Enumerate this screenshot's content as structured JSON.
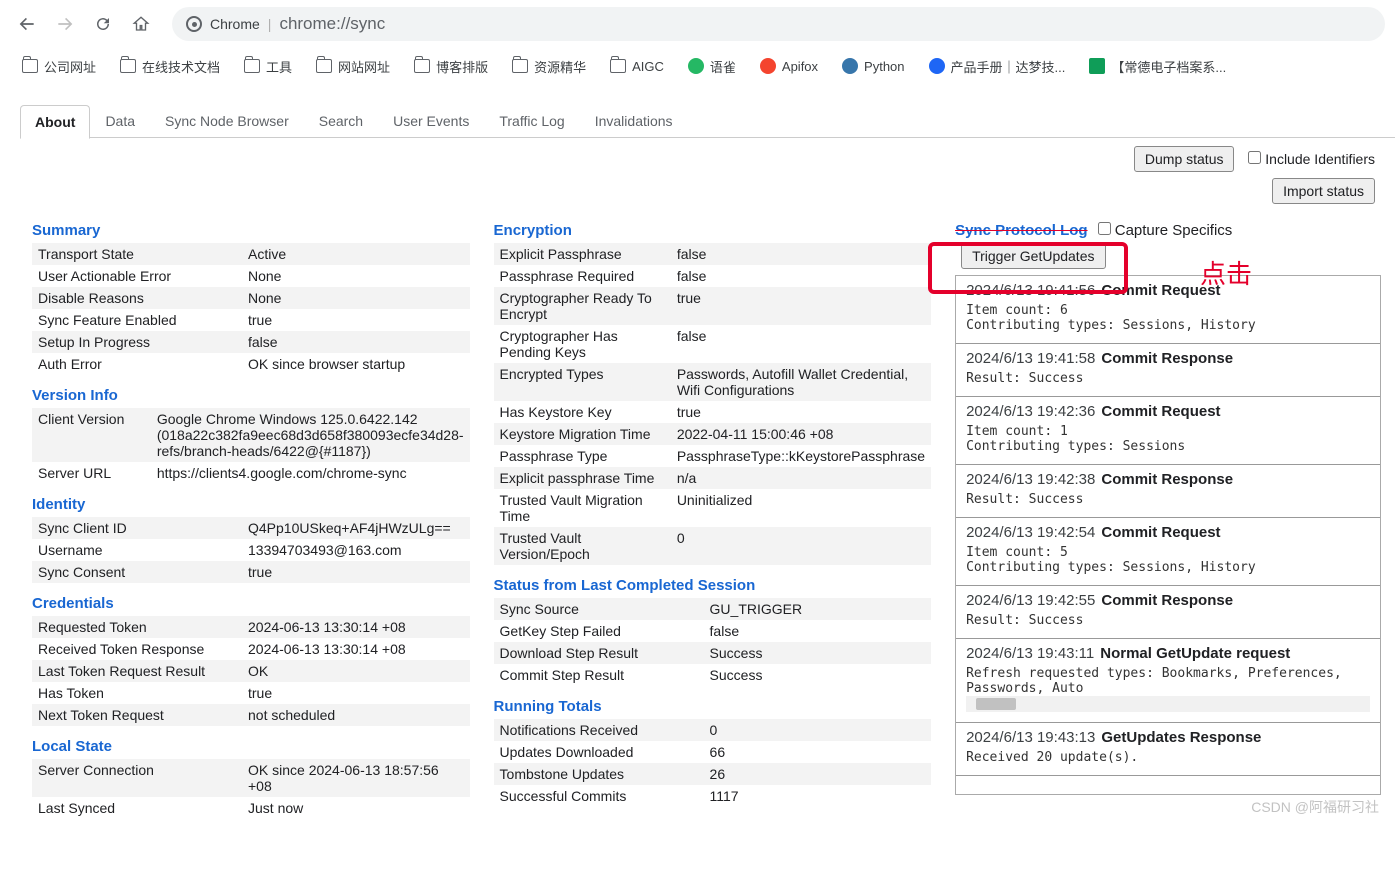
{
  "browser": {
    "address_chip": "Chrome",
    "address_url": "chrome://sync"
  },
  "bookmarks": [
    {
      "label": "公司网址",
      "icon": "folder"
    },
    {
      "label": "在线技术文档",
      "icon": "folder"
    },
    {
      "label": "工具",
      "icon": "folder"
    },
    {
      "label": "网站网址",
      "icon": "folder"
    },
    {
      "label": "博客排版",
      "icon": "folder"
    },
    {
      "label": "资源精华",
      "icon": "folder"
    },
    {
      "label": "AIGC",
      "icon": "folder"
    },
    {
      "label": "语雀",
      "icon": "yuque",
      "color": "#25b864"
    },
    {
      "label": "Apifox",
      "icon": "apifox",
      "color": "#f4442e"
    },
    {
      "label": "Python",
      "icon": "python",
      "color": "#3776ab"
    },
    {
      "label": "产品手册｜达梦技...",
      "icon": "dm",
      "color": "#1e66f5"
    },
    {
      "label": "【常德电子档案系...",
      "icon": "sheets"
    }
  ],
  "tabs": [
    "About",
    "Data",
    "Sync Node Browser",
    "Search",
    "User Events",
    "Traffic Log",
    "Invalidations"
  ],
  "active_tab": "About",
  "controls": {
    "dump": "Dump status",
    "include_identifiers": "Include Identifiers",
    "import": "Import status"
  },
  "col1": {
    "summary": {
      "title": "Summary",
      "rows": [
        [
          "Transport State",
          "Active"
        ],
        [
          "User Actionable Error",
          "None"
        ],
        [
          "Disable Reasons",
          "None"
        ],
        [
          "Sync Feature Enabled",
          "true"
        ],
        [
          "Setup In Progress",
          "false"
        ],
        [
          "Auth Error",
          "OK since browser startup"
        ]
      ]
    },
    "version": {
      "title": "Version Info",
      "rows": [
        [
          "Client Version",
          "Google Chrome Windows 125.0.6422.142 (018a22c382fa9eec68d3d658f380093ecfe34d28-refs/branch-heads/6422@{#1187})"
        ],
        [
          "Server URL",
          "https://clients4.google.com/chrome-sync"
        ]
      ]
    },
    "identity": {
      "title": "Identity",
      "rows": [
        [
          "Sync Client ID",
          "Q4Pp10USkeq+AF4jHWzULg=="
        ],
        [
          "Username",
          "13394703493@163.com"
        ],
        [
          "Sync Consent",
          "true"
        ]
      ]
    },
    "credentials": {
      "title": "Credentials",
      "rows": [
        [
          "Requested Token",
          "2024-06-13 13:30:14 +08"
        ],
        [
          "Received Token Response",
          "2024-06-13 13:30:14 +08"
        ],
        [
          "Last Token Request Result",
          "OK"
        ],
        [
          "Has Token",
          "true"
        ],
        [
          "Next Token Request",
          "not scheduled"
        ]
      ]
    },
    "local_state": {
      "title": "Local State",
      "rows": [
        [
          "Server Connection",
          "OK since 2024-06-13 18:57:56 +08"
        ],
        [
          "Last Synced",
          "Just now"
        ]
      ]
    }
  },
  "col2": {
    "encryption": {
      "title": "Encryption",
      "rows": [
        [
          "Explicit Passphrase",
          "false"
        ],
        [
          "Passphrase Required",
          "false"
        ],
        [
          "Cryptographer Ready To Encrypt",
          "true"
        ],
        [
          "Cryptographer Has Pending Keys",
          "false"
        ],
        [
          "Encrypted Types",
          "Passwords, Autofill Wallet Credential, Wifi Configurations"
        ],
        [
          "Has Keystore Key",
          "true"
        ],
        [
          "Keystore Migration Time",
          "2022-04-11 15:00:46 +08"
        ],
        [
          "Passphrase Type",
          "PassphraseType::kKeystorePassphrase"
        ],
        [
          "Explicit passphrase Time",
          "n/a"
        ],
        [
          "Trusted Vault Migration Time",
          "Uninitialized"
        ],
        [
          "Trusted Vault Version/Epoch",
          "0"
        ]
      ]
    },
    "status": {
      "title": "Status from Last Completed Session",
      "rows": [
        [
          "Sync Source",
          "GU_TRIGGER"
        ],
        [
          "GetKey Step Failed",
          "false"
        ],
        [
          "Download Step Result",
          "Success"
        ],
        [
          "Commit Step Result",
          "Success"
        ]
      ]
    },
    "running": {
      "title": "Running Totals",
      "rows": [
        [
          "Notifications Received",
          "0"
        ],
        [
          "Updates Downloaded",
          "66"
        ],
        [
          "Tombstone Updates",
          "26"
        ],
        [
          "Successful Commits",
          "1117"
        ]
      ]
    }
  },
  "protocol_log": {
    "title": "Sync Protocol Log",
    "capture_label": "Capture Specifics",
    "trigger_btn": "Trigger GetUpdates",
    "entries": [
      {
        "ts": "2024/6/13 19:41:56",
        "name": "Commit Request",
        "body": "Item count: 6\nContributing types: Sessions, History"
      },
      {
        "ts": "2024/6/13 19:41:58",
        "name": "Commit Response",
        "body": "Result: Success"
      },
      {
        "ts": "2024/6/13 19:42:36",
        "name": "Commit Request",
        "body": "Item count: 1\nContributing types: Sessions"
      },
      {
        "ts": "2024/6/13 19:42:38",
        "name": "Commit Response",
        "body": "Result: Success"
      },
      {
        "ts": "2024/6/13 19:42:54",
        "name": "Commit Request",
        "body": "Item count: 5\nContributing types: Sessions, History"
      },
      {
        "ts": "2024/6/13 19:42:55",
        "name": "Commit Response",
        "body": "Result: Success"
      },
      {
        "ts": "2024/6/13 19:43:11",
        "name": "Normal GetUpdate request",
        "body": "Refresh requested types: Bookmarks, Preferences, Passwords, Auto",
        "hscroll": true
      },
      {
        "ts": "2024/6/13 19:43:13",
        "name": "GetUpdates Response",
        "body": "Received 20 update(s)."
      }
    ]
  },
  "annotation": {
    "text": "点击"
  },
  "watermark": "CSDN @阿福研习社"
}
